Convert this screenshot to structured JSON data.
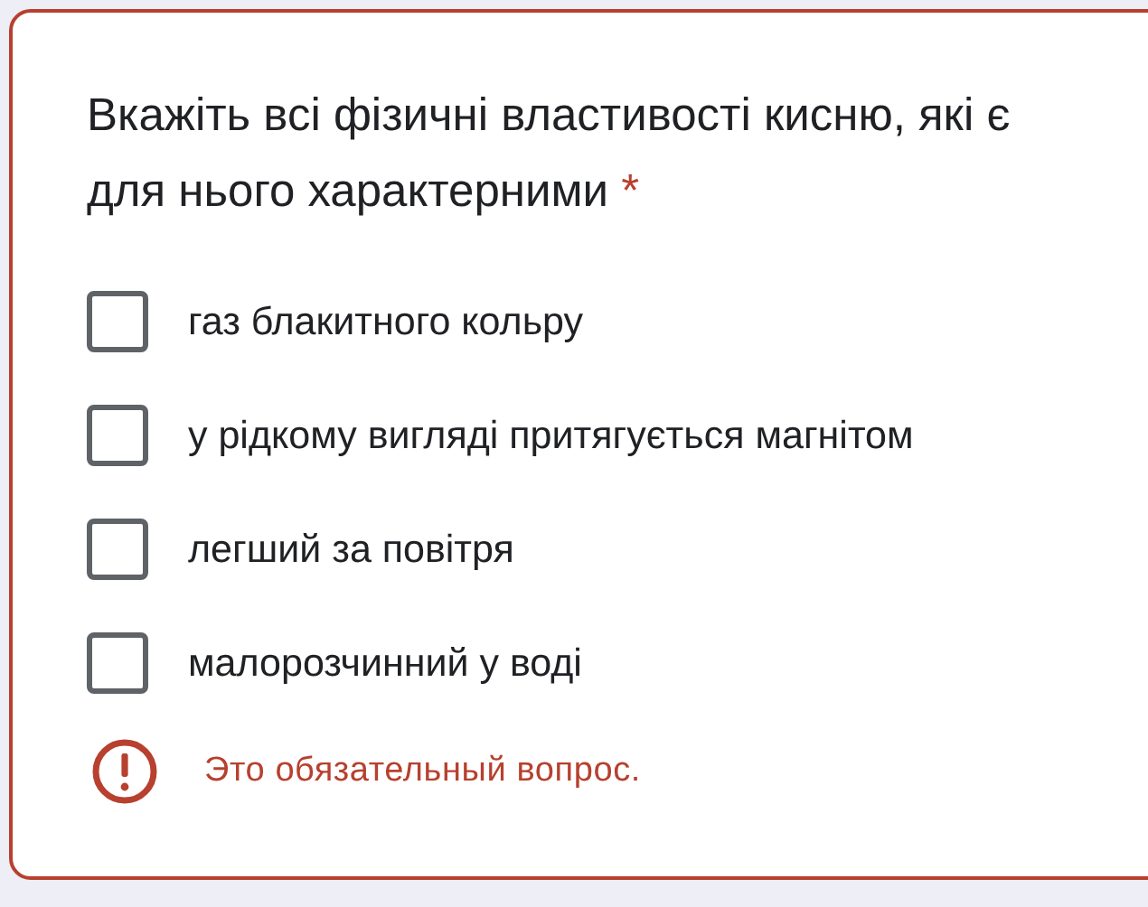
{
  "question": {
    "title": "Вкажіть всі фізичні властивості кисню, які є для нього характерними",
    "required_mark": "*"
  },
  "options": [
    {
      "label": "газ блакитного кольру",
      "checked": false
    },
    {
      "label": "у рідкому вигляді притягується магнітом",
      "checked": false
    },
    {
      "label": "легший за повітря",
      "checked": false
    },
    {
      "label": "малорозчинний у воді",
      "checked": false
    }
  ],
  "error": {
    "message": "Это обязательный вопрос."
  }
}
